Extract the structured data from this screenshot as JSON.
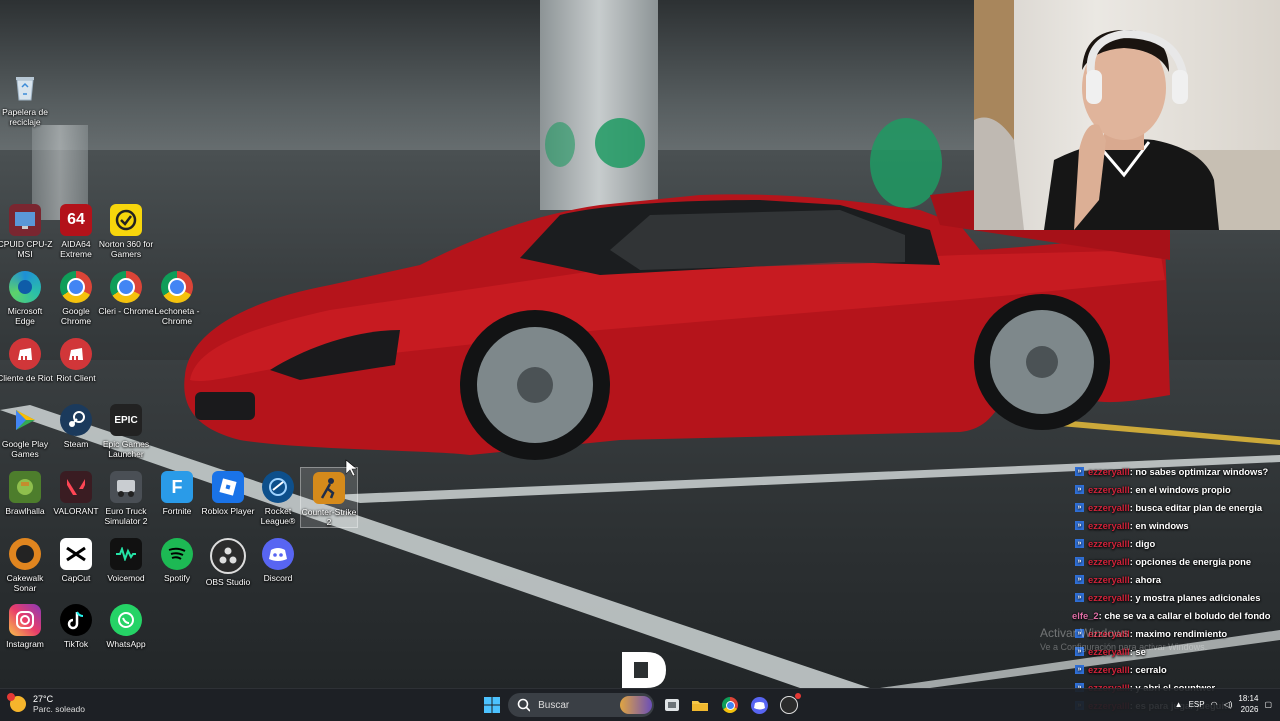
{
  "desktop": {
    "icons": [
      {
        "label": "Papelera de reciclaje",
        "icon": "recycle-bin-icon"
      },
      {
        "label": "CPUID CPU-Z MSI",
        "icon": "cpuz-icon"
      },
      {
        "label": "AIDA64 Extreme",
        "icon": "aida64-icon",
        "tile_text": "64"
      },
      {
        "label": "Norton 360 for Gamers",
        "icon": "norton-icon"
      },
      {
        "label": "Microsoft Edge",
        "icon": "edge-icon"
      },
      {
        "label": "Google Chrome",
        "icon": "chrome-icon"
      },
      {
        "label": "Cleri - Chrome",
        "icon": "chrome-icon"
      },
      {
        "label": "Lechoneta - Chrome",
        "icon": "chrome-icon"
      },
      {
        "label": "Cliente de Riot",
        "icon": "riot-icon"
      },
      {
        "label": "Riot Client",
        "icon": "riot-icon"
      },
      {
        "label": "Google Play Games",
        "icon": "play-games-icon"
      },
      {
        "label": "Steam",
        "icon": "steam-icon"
      },
      {
        "label": "Epic Games Launcher",
        "icon": "epic-icon",
        "tile_text": "EPIC"
      },
      {
        "label": "Brawlhalla",
        "icon": "brawlhalla-icon"
      },
      {
        "label": "VALORANT",
        "icon": "valorant-icon"
      },
      {
        "label": "Euro Truck Simulator 2",
        "icon": "truck-icon"
      },
      {
        "label": "Fortnite",
        "icon": "fortnite-icon",
        "tile_text": "F"
      },
      {
        "label": "Roblox Player",
        "icon": "roblox-icon"
      },
      {
        "label": "Rocket League®",
        "icon": "rocket-league-icon"
      },
      {
        "label": "Counter-Strike 2",
        "icon": "counter-strike-icon"
      },
      {
        "label": "Cakewalk Sonar",
        "icon": "cakewalk-icon"
      },
      {
        "label": "CapCut",
        "icon": "capcut-icon"
      },
      {
        "label": "Voicemod",
        "icon": "voicemod-icon"
      },
      {
        "label": "Spotify",
        "icon": "spotify-icon"
      },
      {
        "label": "OBS Studio",
        "icon": "obs-icon"
      },
      {
        "label": "Discord",
        "icon": "discord-icon"
      },
      {
        "label": "Instagram",
        "icon": "instagram-icon"
      },
      {
        "label": "TikTok",
        "icon": "tiktok-icon"
      },
      {
        "label": "WhatsApp",
        "icon": "whatsapp-icon"
      }
    ]
  },
  "chat": {
    "messages": [
      {
        "user": "ezzeryalll",
        "text": ": no sabes optimizar windows?"
      },
      {
        "user": "ezzeryalll",
        "text": ": en el windows propio"
      },
      {
        "user": "ezzeryalll",
        "text": ": busca editar plan de energia"
      },
      {
        "user": "ezzeryalll",
        "text": ": en windows"
      },
      {
        "user": "ezzeryalll",
        "text": ": digo"
      },
      {
        "user": "ezzeryalll",
        "text": ": opciones de energia pone"
      },
      {
        "user": "ezzeryalll",
        "text": ": ahora"
      },
      {
        "user": "ezzeryalll",
        "text": ": y mostra planes adicionales"
      },
      {
        "user": "elfe_2",
        "text": ": che se va a callar el boludo del fondo"
      },
      {
        "user": "ezzeryalll",
        "text": ": maximo rendimiento"
      },
      {
        "user": "ezzeryalll",
        "text": ": se"
      },
      {
        "user": "ezzeryalll",
        "text": ": cerralo"
      },
      {
        "user": "ezzeryalll",
        "text": ": y abri el countwer"
      },
      {
        "user": "ezzeryalll",
        "text": ": es para jugar jueguito"
      }
    ]
  },
  "watermark": {
    "line1": "Activar Windows",
    "line2": "Ve a Configuración para activar Windows."
  },
  "overlay_logo": "D",
  "taskbar": {
    "weather_temp": "27°C",
    "weather_desc": "Parc. soleado",
    "search_placeholder": "Buscar",
    "lang": "ESP",
    "time": "18:14",
    "date": "2026"
  },
  "colors": {
    "chat_user": "#d0233a",
    "chat_user_alt": "#e06fa7",
    "badge": "#2f6fd6",
    "car_red": "#c0161d"
  }
}
